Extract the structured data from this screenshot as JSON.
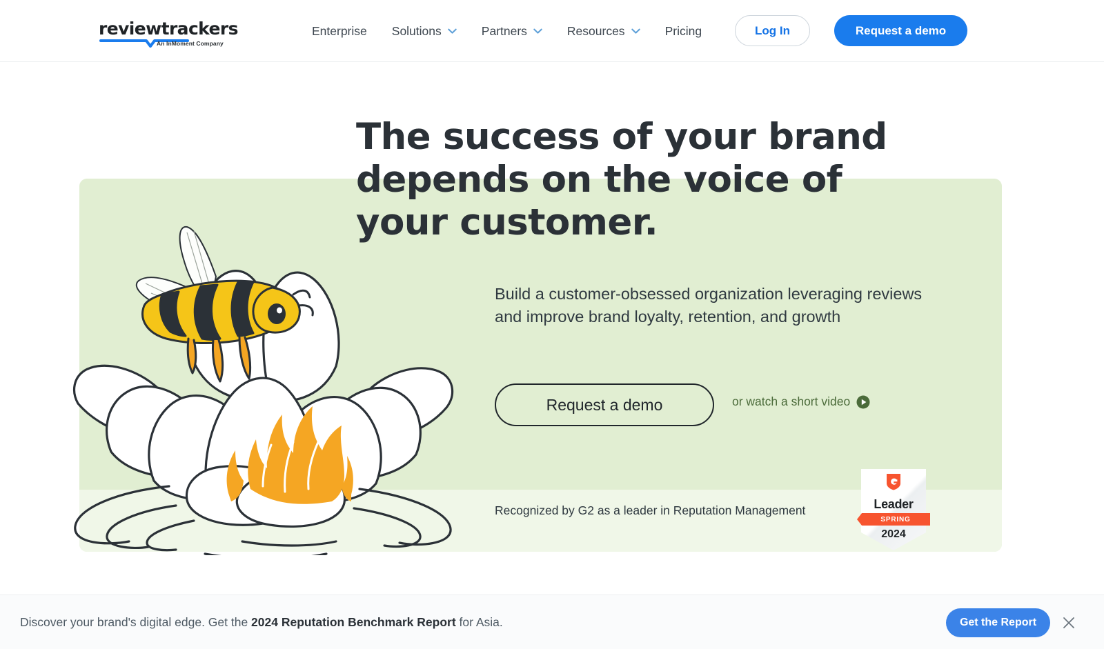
{
  "header": {
    "logo": {
      "wordmark": "reviewtrackers",
      "tagline": "An InMoment Company",
      "swoosh_icon": "underline-swoosh-icon",
      "brand_color": "#1a7ced"
    },
    "nav": [
      {
        "label": "Enterprise",
        "has_dropdown": false
      },
      {
        "label": "Solutions",
        "has_dropdown": true,
        "icon": "chevron-down-icon"
      },
      {
        "label": "Partners",
        "has_dropdown": true,
        "icon": "chevron-down-icon"
      },
      {
        "label": "Resources",
        "has_dropdown": true,
        "icon": "chevron-down-icon"
      },
      {
        "label": "Pricing",
        "has_dropdown": false
      }
    ],
    "login_label": "Log In",
    "demo_label": "Request a demo"
  },
  "hero": {
    "headline": "The success of your brand depends on the voice of your customer.",
    "subheadline": "Build a customer-obsessed organization leveraging reviews and improve brand loyalty, retention, and growth",
    "cta_label": "Request a demo",
    "video_label": "or watch a short video",
    "video_icon": "play-circle-icon",
    "recognition_text": "Recognized by G2 as a leader in Reputation Management",
    "illustration": "lotus-flower-with-bee-illustration",
    "card_color": "#e1eed2",
    "strip_color": "#f0f7e8"
  },
  "g2_badge": {
    "logo_text": "G2",
    "award": "Leader",
    "season": "SPRING",
    "year": "2024",
    "accent_color": "#f7542f"
  },
  "banner": {
    "text_before": "Discover your brand's digital edge. Get the ",
    "text_bold": "2024 Reputation Benchmark Report",
    "text_after": " for Asia.",
    "cta_label": "Get the Report",
    "close_icon": "close-icon"
  }
}
